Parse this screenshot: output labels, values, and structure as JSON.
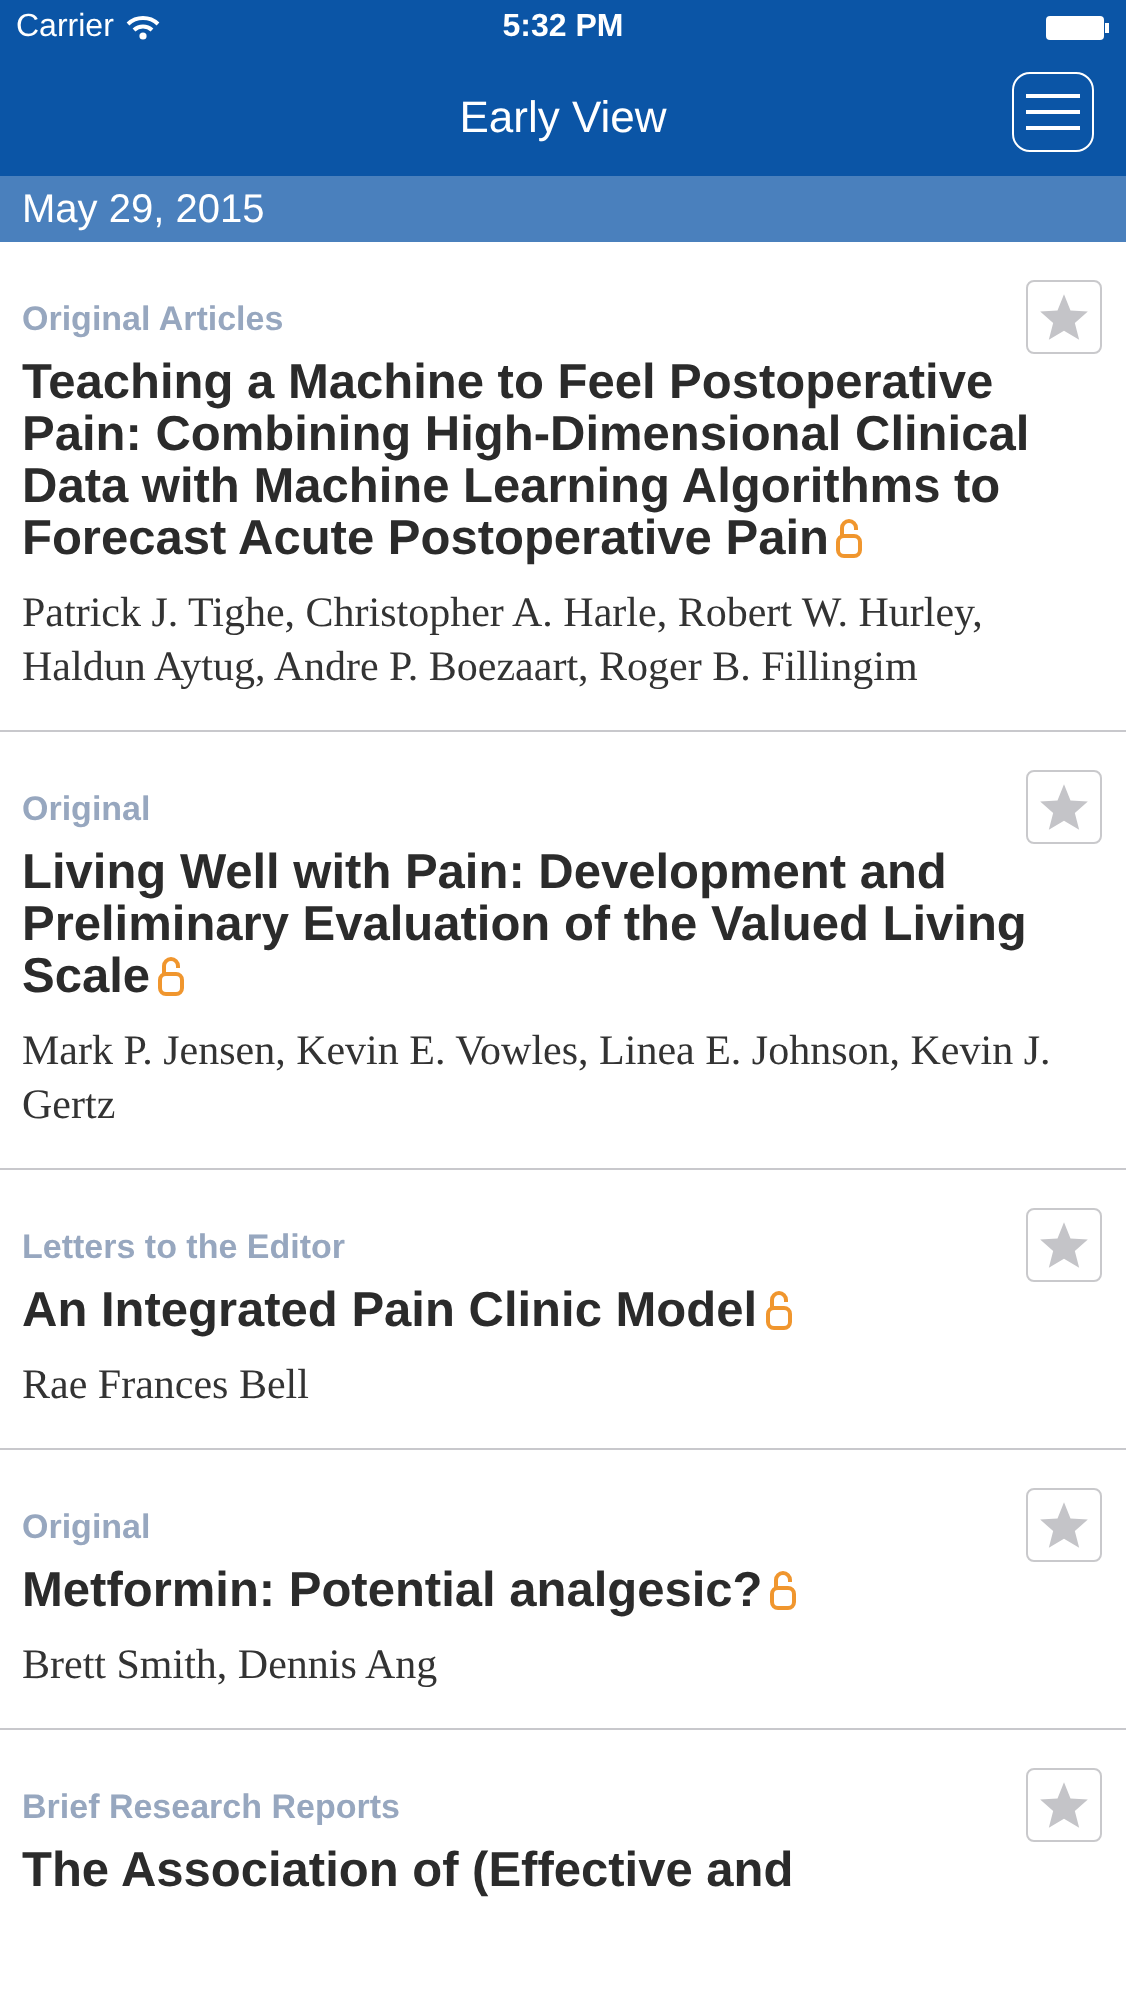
{
  "status_bar": {
    "carrier": "Carrier",
    "time": "5:32 PM"
  },
  "nav": {
    "title": "Early View"
  },
  "section": {
    "date": "May 29, 2015"
  },
  "articles": [
    {
      "category": "Original Articles",
      "title": "Teaching a Machine to Feel Postoperative Pain: Combining High-Dimensional Clinical Data with Machine Learning Algorithms to Forecast Acute Postoperative Pain",
      "authors": "Patrick J. Tighe, Christopher A. Harle, Robert W. Hurley, Haldun Aytug, Andre P. Boezaart, Roger B. Fillingim",
      "open_access": true,
      "starred": false
    },
    {
      "category": "Original",
      "title": "Living Well with Pain: Development and Preliminary Evaluation of the Valued Living Scale",
      "authors": "Mark P. Jensen, Kevin E. Vowles, Linea E. Johnson, Kevin J. Gertz",
      "open_access": true,
      "starred": false
    },
    {
      "category": "Letters to the Editor",
      "title": "An Integrated Pain Clinic Model",
      "authors": "Rae Frances Bell",
      "open_access": true,
      "starred": false
    },
    {
      "category": "Original",
      "title": "Metformin: Potential analgesic?",
      "authors": "Brett Smith, Dennis Ang",
      "open_access": true,
      "starred": false
    },
    {
      "category": "Brief Research Reports",
      "title": "The Association of (Effective and",
      "starred": false
    }
  ]
}
